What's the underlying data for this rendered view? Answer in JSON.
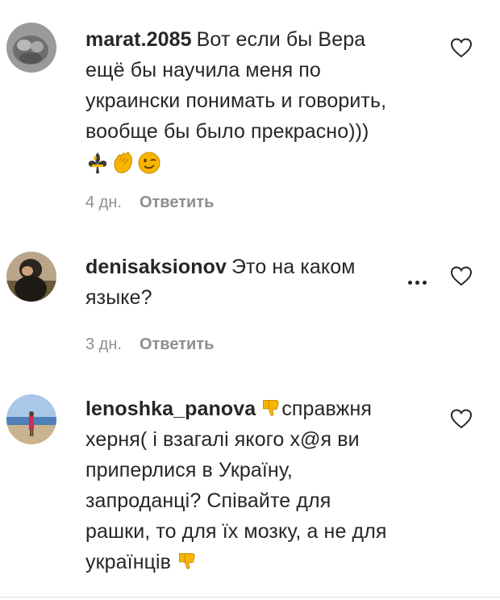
{
  "comments": [
    {
      "username": "marat.2085",
      "lines": [
        "Вот если бы Вера",
        "ещё бы научила меня по",
        "украински понимать и говорить,",
        "вообще бы было прекрасно)))"
      ],
      "emojis": [
        "fleur-de-lis-emoji",
        "clapping-hands-emoji",
        "winking-face-emoji"
      ],
      "time": "4 дн.",
      "reply_label": "Ответить",
      "avatar": "fist-avatar"
    },
    {
      "username": "denisaksionov",
      "lines": [
        "Это на каком",
        "языке?"
      ],
      "time": "3 дн.",
      "reply_label": "Ответить",
      "avatar": "person-avatar"
    },
    {
      "username": "lenoshka_panova",
      "text_after_emoji": "справжня",
      "lines": [
        "херня( і взагалі якого х@я ви",
        "приперлися в Україну,",
        "запроданці? Співайте для",
        "рашки, то для їх мозку, а не для",
        "українців"
      ],
      "leading_emoji": "thumbs-down-emoji",
      "trailing_emoji": "thumbs-down-emoji",
      "avatar": "beach-avatar"
    }
  ],
  "colors": {
    "text": "#262626",
    "meta": "#8e8e8e",
    "emoji_yellow": "#f7b500"
  }
}
